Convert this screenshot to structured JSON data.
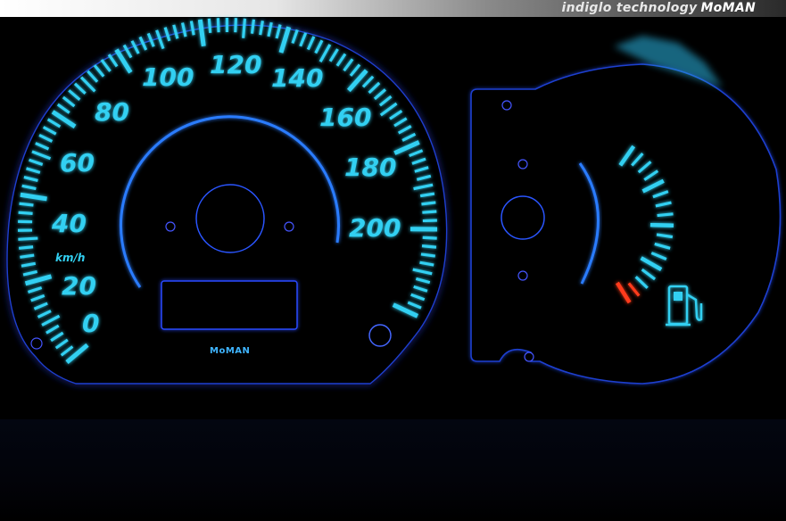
{
  "banner": {
    "text": "indiglo technology",
    "logo": "MoMAN"
  },
  "speedometer": {
    "labels": [
      "0",
      "20",
      "40",
      "60",
      "80",
      "100",
      "120",
      "140",
      "160",
      "180",
      "200"
    ],
    "unit": "km/h",
    "brand": "MoMAN"
  },
  "fuel_gauge": {
    "icon": "fuel-pump-icon"
  },
  "colors": {
    "glow": "#32d0f2",
    "accent_red": "#ff3a1a",
    "bezel": "#0b0f2a"
  }
}
